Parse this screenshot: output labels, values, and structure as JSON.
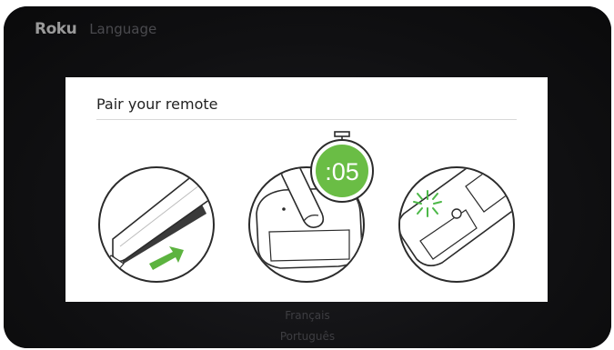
{
  "header": {
    "logo": "Roku",
    "title": "Language"
  },
  "modal": {
    "title": "Pair your remote",
    "timer": ":05"
  },
  "languages": [
    {
      "label": "Français"
    },
    {
      "label": "Português"
    }
  ],
  "colors": {
    "timer_green": "#6abd45",
    "arrow_green": "#5cb33f",
    "led_green": "#4db848"
  },
  "icons": {
    "step1": "remote-battery-slide-icon",
    "step2": "press-pair-button-icon",
    "step3": "pairing-light-icon",
    "timer": "stopwatch-icon"
  }
}
